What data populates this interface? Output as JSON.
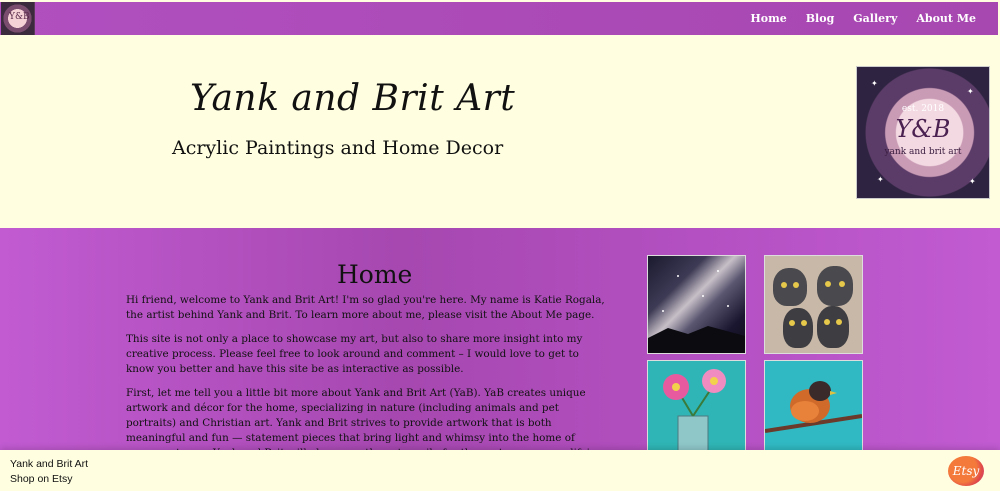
{
  "nav": {
    "logo_text": "Y&B",
    "links": [
      "Home",
      "Blog",
      "Gallery",
      "About Me"
    ]
  },
  "header": {
    "title": "Yank and Brit Art",
    "subtitle": "Acrylic Paintings and Home Decor",
    "logo": {
      "est": "est. 2018",
      "monogram": "Y&B",
      "tagline": "yank and brit art"
    }
  },
  "main": {
    "heading": "Home",
    "paragraphs": [
      "Hi friend, welcome to Yank and Brit Art! I'm so glad you're here. My name is Katie Rogala, the artist behind Yank and Brit. To learn more about me, please visit the About Me page.",
      "This site is not only a place to showcase my art, but also to share more insight into my creative process. Please feel free to look around and comment – I would love to get to know you better and have this site be as interactive as possible.",
      "First, let me tell you a little bit more about Yank and Brit Art (YaB). YaB creates unique artwork and décor for the home, specializing in nature (including animals and pet portraits) and Christian art. Yank and Brit strives to provide artwork that is both meaningful and fun — statement pieces that bring light and whimsy into the home of every customer. Yank and Brit will always go the extra mile for the customer, exemplifying stellar service, kindness, collaboration and"
    ]
  },
  "footer": {
    "title": "Yank and Brit Art",
    "link": "Shop on Etsy",
    "badge": "Etsy"
  },
  "colors": {
    "accent_purple": "#b04fbf",
    "background": "#fffee0"
  }
}
